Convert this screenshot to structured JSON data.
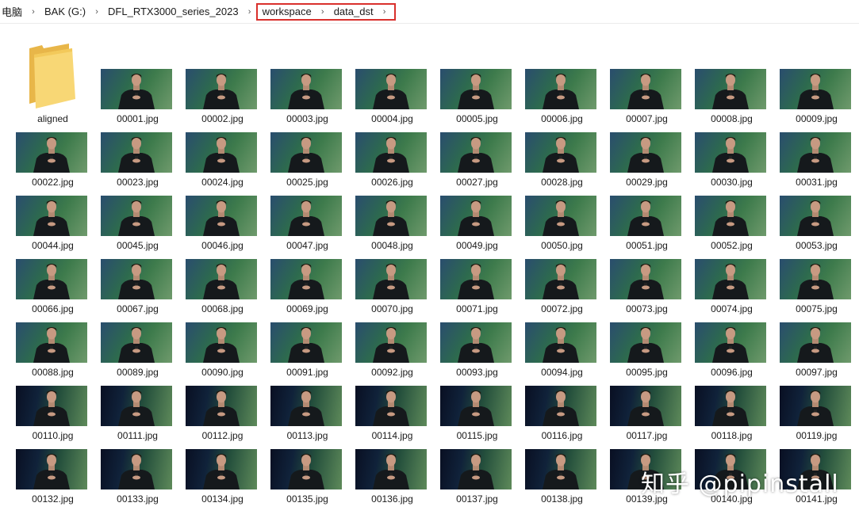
{
  "breadcrumb": {
    "items": [
      "电脑",
      "BAK (G:)",
      "DFL_RTX3000_series_2023",
      "workspace",
      "data_dst"
    ],
    "separator": "›"
  },
  "highlight_color": "#d9302c",
  "folder": {
    "label": "aligned",
    "icon": "folder-icon"
  },
  "files": [
    "00001.jpg",
    "00002.jpg",
    "00003.jpg",
    "00004.jpg",
    "00005.jpg",
    "00006.jpg",
    "00007.jpg",
    "00008.jpg",
    "00009.jpg",
    "00022.jpg",
    "00023.jpg",
    "00024.jpg",
    "00025.jpg",
    "00026.jpg",
    "00027.jpg",
    "00028.jpg",
    "00029.jpg",
    "00030.jpg",
    "00031.jpg",
    "00044.jpg",
    "00045.jpg",
    "00046.jpg",
    "00047.jpg",
    "00048.jpg",
    "00049.jpg",
    "00050.jpg",
    "00051.jpg",
    "00052.jpg",
    "00053.jpg",
    "00066.jpg",
    "00067.jpg",
    "00068.jpg",
    "00069.jpg",
    "00070.jpg",
    "00071.jpg",
    "00072.jpg",
    "00073.jpg",
    "00074.jpg",
    "00075.jpg",
    "00088.jpg",
    "00089.jpg",
    "00090.jpg",
    "00091.jpg",
    "00092.jpg",
    "00093.jpg",
    "00094.jpg",
    "00095.jpg",
    "00096.jpg",
    "00097.jpg",
    "00110.jpg",
    "00111.jpg",
    "00112.jpg",
    "00113.jpg",
    "00114.jpg",
    "00115.jpg",
    "00116.jpg",
    "00117.jpg",
    "00118.jpg",
    "00119.jpg",
    "00132.jpg",
    "00133.jpg",
    "00134.jpg",
    "00135.jpg",
    "00136.jpg",
    "00137.jpg",
    "00138.jpg",
    "00139.jpg",
    "00140.jpg",
    "00141.jpg"
  ],
  "watermark": "知乎 @pipinstall"
}
